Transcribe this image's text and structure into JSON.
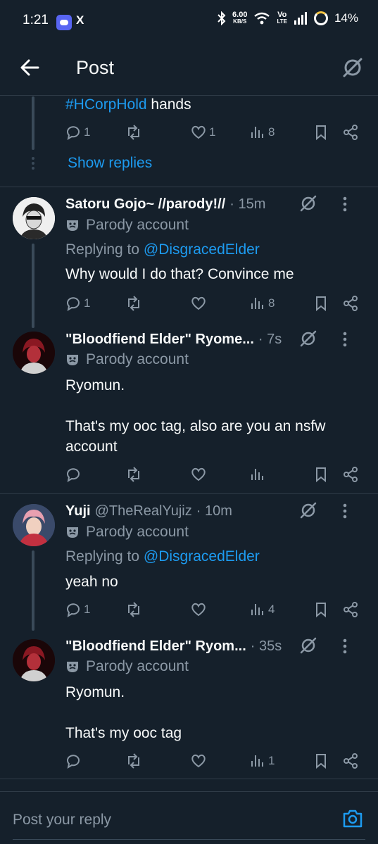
{
  "status_bar": {
    "time": "1:21",
    "x_label": "X",
    "net_speed": "6.00",
    "net_unit": "KB/S",
    "volte_top": "Vo",
    "volte_bottom": "LTE",
    "battery": "14%"
  },
  "header": {
    "title": "Post"
  },
  "top_post": {
    "hashtag": "#HCorpHold",
    "text_rest": " hands",
    "replies": "1",
    "reposts": "",
    "likes": "1",
    "views": "8",
    "show_replies": "Show replies"
  },
  "posts": [
    {
      "display_name": "Satoru Gojo~ //parody!//",
      "handle": "",
      "time": "· 15m",
      "parody_label": "Parody account",
      "replying_prefix": "Replying to ",
      "replying_to": "@DisgracedElder",
      "text": "Why would I do that? Convince me",
      "replies": "1",
      "likes": "",
      "views": "8"
    },
    {
      "display_name": "\"Bloodfiend Elder\" Ryome...",
      "handle": "",
      "time": "· 7s",
      "parody_label": "Parody account",
      "text": "Ryomun.\n\nThat's my ooc tag, also are you an nsfw account",
      "replies": "",
      "likes": "",
      "views": ""
    },
    {
      "display_name": "Yuji",
      "handle": "@TheRealYujiz",
      "time": "· 10m",
      "parody_label": "Parody account",
      "replying_prefix": "Replying to ",
      "replying_to": "@DisgracedElder",
      "text": "yeah no",
      "replies": "1",
      "likes": "",
      "views": "4"
    },
    {
      "display_name": "\"Bloodfiend Elder\" Ryom...",
      "handle": "",
      "time": "· 35s",
      "parody_label": "Parody account",
      "text": "Ryomun.\n\nThat's my ooc tag",
      "replies": "",
      "likes": "",
      "views": "1"
    }
  ],
  "reply_bar": {
    "placeholder": "Post your reply"
  },
  "icons": {
    "back": "back-arrow-icon",
    "grok": "grok-icon",
    "reply": "reply-icon",
    "repost": "repost-icon",
    "like": "heart-icon",
    "views": "views-icon",
    "bookmark": "bookmark-icon",
    "share": "share-icon",
    "camera": "camera-icon",
    "more": "more-vertical-icon",
    "parody": "parody-mask-icon"
  },
  "colors": {
    "background": "#15202b",
    "accent": "#1d9bf0",
    "muted": "#8b98a5",
    "text": "#f7f9f9"
  }
}
